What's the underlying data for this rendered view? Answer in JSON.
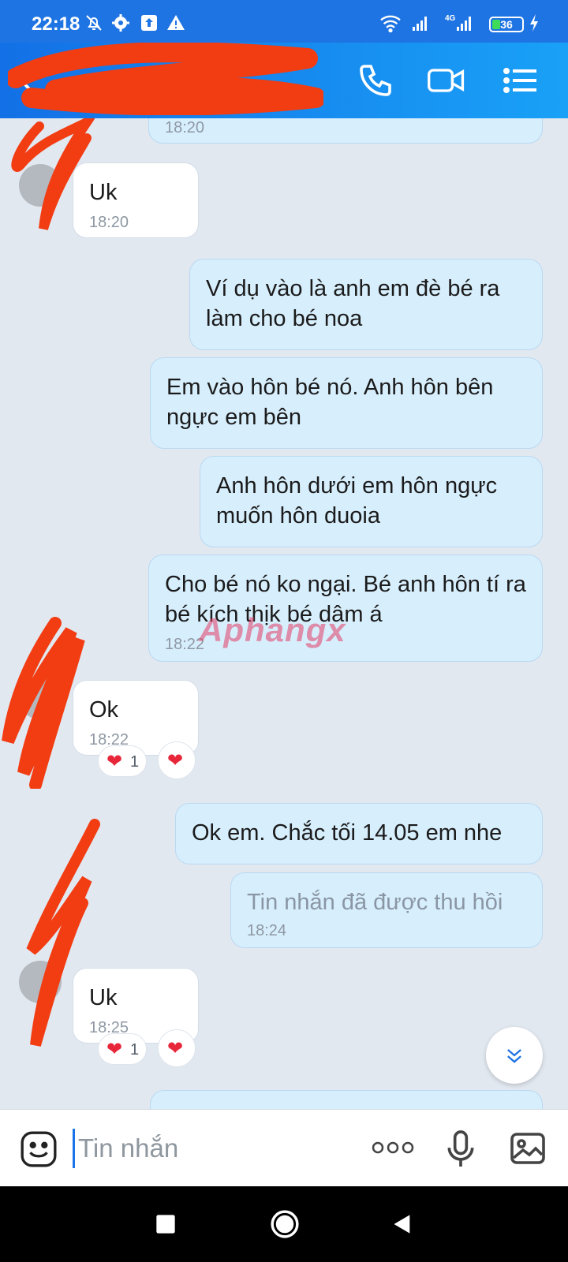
{
  "status_bar": {
    "time": "22:18",
    "battery": "36",
    "network": "4G",
    "icons": [
      "bell-off-icon",
      "gear-icon",
      "upload-icon",
      "warning-icon",
      "wifi-icon",
      "signal-icon",
      "signal-icon",
      "charging-icon"
    ]
  },
  "header": {
    "contact_name": "",
    "icons": [
      "back-icon",
      "phone-icon",
      "video-call-icon",
      "menu-list-icon"
    ],
    "colors": {
      "gradient_start": "#1370e6",
      "gradient_end": "#19a1f7"
    }
  },
  "messages": [
    {
      "dir": "out",
      "text": "",
      "time": "18:20"
    },
    {
      "dir": "in",
      "text": "Uk",
      "time": "18:20"
    },
    {
      "dir": "out",
      "text": "Ví dụ vào là anh em đè bé ra làm cho bé noa",
      "time": ""
    },
    {
      "dir": "out",
      "text": "Em vào hôn bé nó. Anh hôn bên ngực em bên",
      "time": ""
    },
    {
      "dir": "out",
      "text": "Anh hôn dưới em hôn ngực muốn hôn duoia",
      "time": ""
    },
    {
      "dir": "out",
      "text": "Cho bé nó ko ngại. Bé anh hôn tí ra bé kích thịk bé dâm á",
      "time": "18:22"
    },
    {
      "dir": "in",
      "text": "Ok",
      "time": "18:22",
      "reactions": [
        {
          "icon": "heart-icon",
          "count": "1"
        },
        {
          "icon": "heart-icon",
          "count": ""
        }
      ]
    },
    {
      "dir": "out",
      "text": "Ok em. Chắc tối 14.05 em nhe",
      "time": ""
    },
    {
      "dir": "out",
      "text": "Tin nhắn đã được thu hồi",
      "time": "18:24",
      "recalled": true
    },
    {
      "dir": "in",
      "text": "Uk",
      "time": "18:25",
      "reactions": [
        {
          "icon": "heart-icon",
          "count": "1"
        },
        {
          "icon": "heart-icon",
          "count": ""
        }
      ]
    }
  ],
  "watermark": "Aphangx",
  "composer": {
    "placeholder": "Tin nhắn",
    "icons": [
      "emoji-icon",
      "more-icon",
      "microphone-icon",
      "image-icon"
    ]
  },
  "nav_bar": {
    "icons": [
      "recents-icon",
      "home-icon",
      "back-icon"
    ]
  },
  "colors": {
    "outgoing_bubble": "#d7eefc",
    "incoming_bubble": "#ffffff",
    "chat_background": "#e2e8f0",
    "reaction_heart": "#e8263a"
  }
}
